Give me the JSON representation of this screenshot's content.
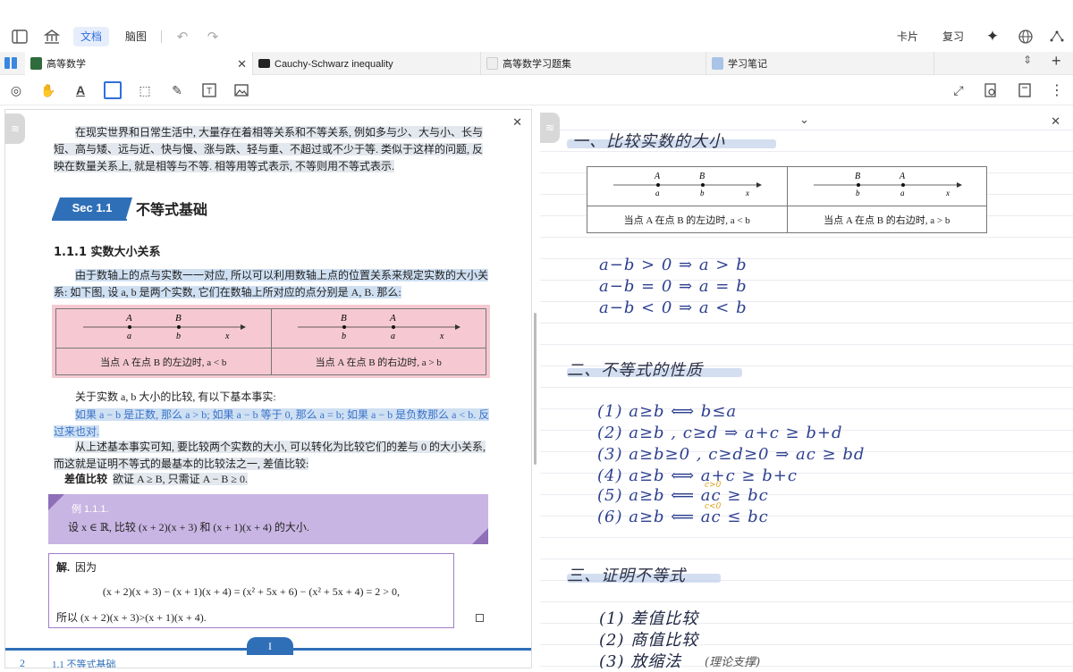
{
  "titlebar": {
    "seg_doc": "文档",
    "seg_mind": "脑图",
    "card": "卡片",
    "review": "复习"
  },
  "tabs": [
    {
      "label": "高等数学",
      "active": true,
      "icon_color": "#2f6b3c"
    },
    {
      "label": "Cauchy-Schwarz inequality",
      "active": false,
      "icon_color": "#222222"
    },
    {
      "label": "高等数学习题集",
      "active": false,
      "icon_color": "#dddddd"
    },
    {
      "label": "学习笔记",
      "active": false,
      "icon_color": "#a9c4e6"
    }
  ],
  "pdf": {
    "intro": "在现实世界和日常生活中, 大量存在着相等关系和不等关系, 例如多与少、大与小、长与短、高与矮、远与近、快与慢、涨与跌、轻与重、不超过或不少于等. 类似于这样的问题, 反映在数量关系上, 就是相等与不等. 相等用等式表示, 不等则用不等式表示.",
    "sec_badge": "Sec 1.1",
    "sec_title": "不等式基础",
    "sub_title": "1.1.1   实数大小关系",
    "para1": "由于数轴上的点与实数一一对应, 所以可以利用数轴上点的位置关系来规定实数的大小关系: 如下图, 设 a, b 是两个实数, 它们在数轴上所对应的点分别是 A, B. 那么:",
    "table_left_caption": "当点 A 在点 B 的左边时, a < b",
    "table_right_caption": "当点 A 在点 B 的右边时, a > b",
    "para2": "关于实数 a, b 大小的比较, 有以下基本事实:",
    "para3": "如果 a − b 是正数, 那么 a > b; 如果 a − b 等于 0, 那么 a = b; 如果 a − b 是负数那么 a < b. 反过来也对.",
    "para4": "从上述基本事实可知, 要比较两个实数的大小, 可以转化为比较它们的差与 0 的大小关系, 而这就是证明不等式的最基本的比较法之一, 差值比较:",
    "diff_label": "差值比较",
    "diff_text": "欲证 A ≥ B, 只需证 A − B ≥ 0.",
    "example_tag": "例 1.1.1.",
    "example_body": "设 x ∈ ℝ, 比较 (x + 2)(x + 3) 和 (x + 1)(x + 4) 的大小.",
    "sol_label": "解.",
    "sol_lead": "因为",
    "sol_eq": "(x + 2)(x + 3) − (x + 1)(x + 4) = (x² + 5x + 6) − (x² + 5x + 4) = 2 > 0,",
    "sol_conclusion": "所以 (x + 2)(x + 3)>(x + 1)(x + 4).",
    "page_number": "2",
    "footer_section": "1.1   不等式基础",
    "page_tab": "I"
  },
  "numberline": {
    "left": {
      "labels_top": [
        "A",
        "B"
      ],
      "labels_bottom": [
        "a",
        "b"
      ],
      "axis": "x"
    },
    "right": {
      "labels_top": [
        "B",
        "A"
      ],
      "labels_bottom": [
        "b",
        "a"
      ],
      "axis": "x"
    }
  },
  "notes": {
    "heading1": "一、比较实数的大小",
    "table_left_caption": "当点 A 在点 B 的左边时, a < b",
    "table_right_caption": "当点 A 在点 B 的右边时, a > b",
    "rules1": [
      "a−b > 0   ⇒   a > b",
      "a−b = 0   ⇒   a = b",
      "a−b < 0   ⇒   a < b"
    ],
    "heading2": "二、不等式的性质",
    "rules2": [
      "(1)  a≥b  ⟺  b≤a",
      "(2)  a≥b , c≥d ⇒   a+c ≥ b+d",
      "(3)  a≥b≥0 , c≥d≥0  ⇒  ac ≥ bd",
      "(4)  a≥b  ⟺  a+c ≥ b+c",
      "(5)  a≥b  ⟸  ac ≥ bc",
      "(6)  a≥b  ⟸  ac ≤ bc"
    ],
    "cond5": "c>0",
    "cond6": "c<0",
    "heading3": "三、证明不等式",
    "methods": [
      "(1) 差值比较",
      "(2) 商值比较",
      "(3) 放缩法"
    ],
    "method3_note": "(理论支撑)"
  }
}
